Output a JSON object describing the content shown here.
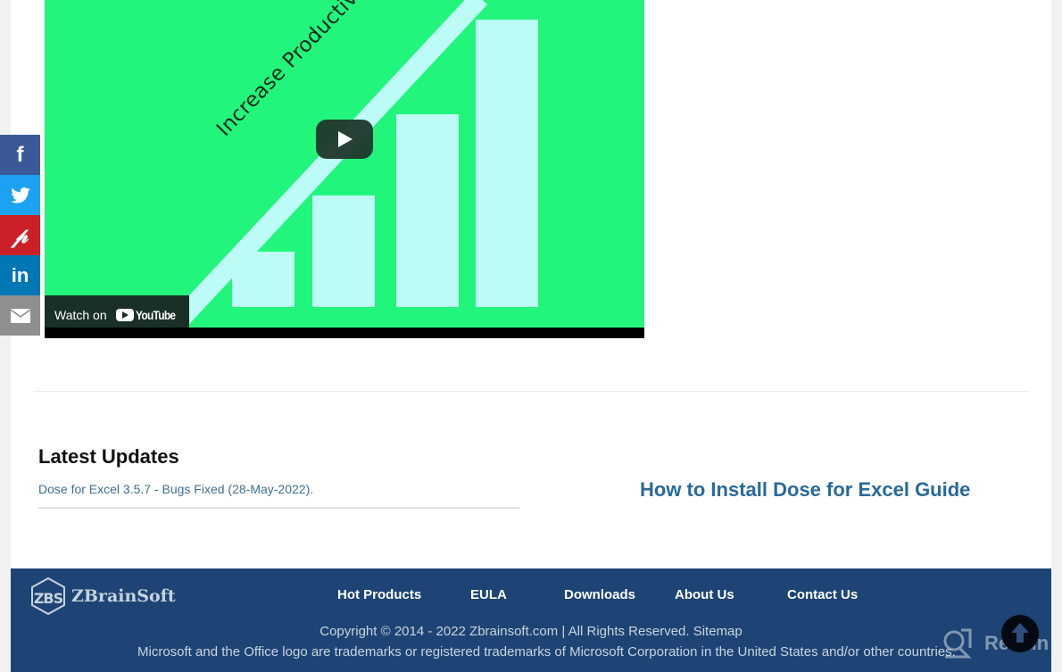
{
  "video": {
    "title_overlay": "Increase Productivity",
    "watch_on_label": "Watch on",
    "youtube_label": "YouTube",
    "play_icon": "play-icon",
    "colors": {
      "background": "#22f57c",
      "bars": "#bdfcf6"
    }
  },
  "social": {
    "items": [
      {
        "name": "facebook",
        "glyph": "f",
        "color": "#3b5998"
      },
      {
        "name": "twitter",
        "glyph": "twitter-bird-icon",
        "color": "#1da1f2"
      },
      {
        "name": "pinterest",
        "glyph": "P",
        "color": "#cb2027"
      },
      {
        "name": "linkedin",
        "glyph": "in",
        "color": "#0077b5"
      },
      {
        "name": "email",
        "glyph": "envelope-icon",
        "color": "#8f8f8f"
      }
    ]
  },
  "latest_updates": {
    "title": "Latest Updates",
    "items": [
      {
        "text": "Dose for Excel 3.5.7 - Bugs Fixed (28-May-2022)."
      }
    ]
  },
  "guide_link": "How to Install Dose for Excel Guide",
  "footer": {
    "brand": "ZBrainSoft",
    "logo_mark": "ZBS",
    "nav": [
      "Hot Products",
      "EULA",
      "Downloads",
      "About Us",
      "Contact Us"
    ],
    "copyright": "Copyright © 2014 - 2022 Zbrainsoft.com | All Rights Reserved.",
    "sitemap": "Sitemap",
    "trademark": "Microsoft and the Office logo are trademarks or registered trademarks of Microsoft Corporation in the United States and/or other countries.",
    "colors": {
      "background": "#1d4474"
    }
  },
  "overlays": {
    "scroll_top_icon": "arrow-up-icon",
    "watermark": "Revain"
  }
}
